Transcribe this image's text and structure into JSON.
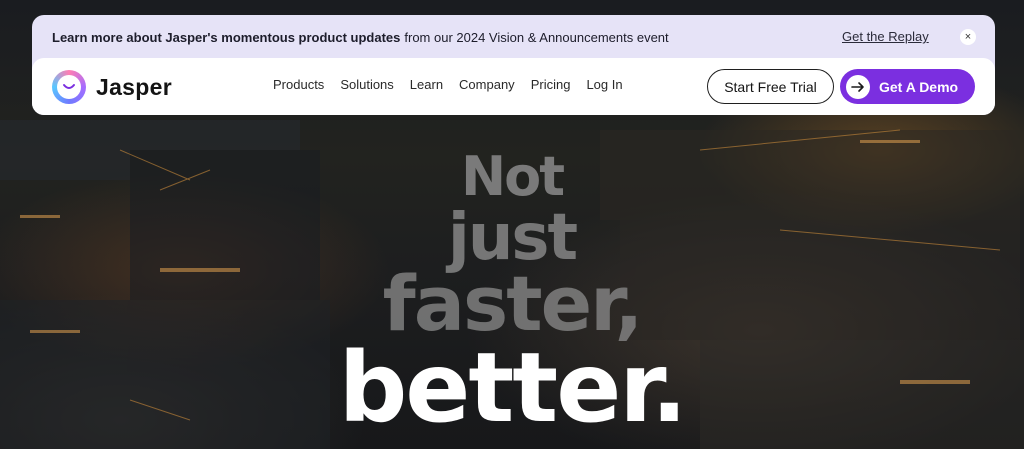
{
  "banner": {
    "bold_text": "Learn more about Jasper's momentous product updates",
    "text": "from our 2024 Vision & Announcements event",
    "link_label": "Get the Replay",
    "close_label": "×"
  },
  "nav": {
    "brand": "Jasper",
    "links": [
      "Products",
      "Solutions",
      "Learn",
      "Company",
      "Pricing",
      "Log In"
    ],
    "trial_label": "Start Free Trial",
    "demo_label": "Get A Demo"
  },
  "hero": {
    "lines": [
      "Not",
      "just",
      "faster,",
      "better."
    ]
  },
  "colors": {
    "accent": "#7b2fe0",
    "banner_bg": "#e6e3f7"
  }
}
